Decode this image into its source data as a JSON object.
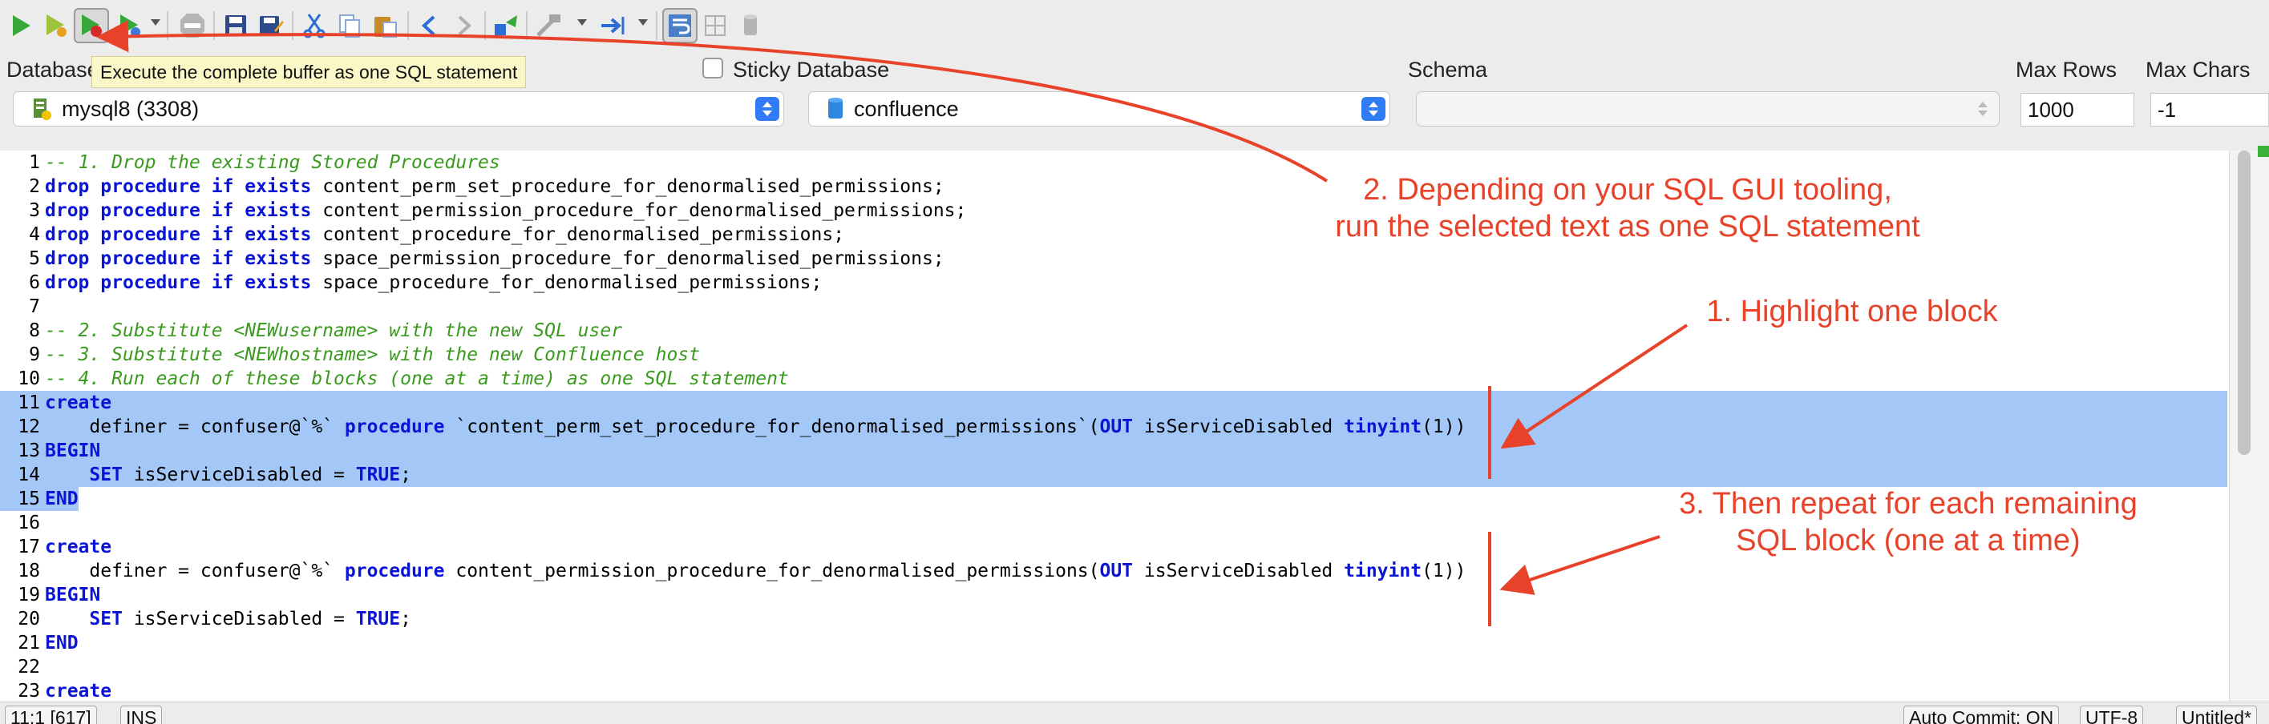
{
  "toolbar": {
    "tooltip": "Execute the complete buffer as one SQL statement",
    "icons": [
      "execute-icon",
      "execute-selection-icon",
      "execute-buffer-icon",
      "execute-debug-icon",
      "stop-icon",
      "save-icon",
      "save-as-icon",
      "cut-icon",
      "copy-icon",
      "paste-icon",
      "undo-icon",
      "redo-icon",
      "run-script-icon",
      "tools-icon",
      "step-icon",
      "word-wrap-icon",
      "grid-icon",
      "database-icon"
    ]
  },
  "connection": {
    "database_label": "Database",
    "sticky_label": "Sticky Database",
    "sticky_checked": false,
    "schema_label": "Schema",
    "max_rows_label": "Max Rows",
    "max_chars_label": "Max Chars",
    "connection_value": "mysql8 (3308)",
    "database_value": "confluence",
    "schema_value": "",
    "max_rows_value": "1000",
    "max_chars_value": "-1"
  },
  "editor": {
    "lines": [
      {
        "n": "1",
        "segments": [
          {
            "t": "-- 1. Drop the existing Stored Procedures",
            "k": "c"
          }
        ]
      },
      {
        "n": "2",
        "segments": [
          {
            "t": "drop",
            "k": "k"
          },
          {
            "t": " "
          },
          {
            "t": "procedure",
            "k": "k"
          },
          {
            "t": " "
          },
          {
            "t": "if",
            "k": "k"
          },
          {
            "t": " "
          },
          {
            "t": "exists",
            "k": "k"
          },
          {
            "t": " content_perm_set_procedure_for_denormalised_permissions;"
          }
        ]
      },
      {
        "n": "3",
        "segments": [
          {
            "t": "drop",
            "k": "k"
          },
          {
            "t": " "
          },
          {
            "t": "procedure",
            "k": "k"
          },
          {
            "t": " "
          },
          {
            "t": "if",
            "k": "k"
          },
          {
            "t": " "
          },
          {
            "t": "exists",
            "k": "k"
          },
          {
            "t": " content_permission_procedure_for_denormalised_permissions;"
          }
        ]
      },
      {
        "n": "4",
        "segments": [
          {
            "t": "drop",
            "k": "k"
          },
          {
            "t": " "
          },
          {
            "t": "procedure",
            "k": "k"
          },
          {
            "t": " "
          },
          {
            "t": "if",
            "k": "k"
          },
          {
            "t": " "
          },
          {
            "t": "exists",
            "k": "k"
          },
          {
            "t": " content_procedure_for_denormalised_permissions;"
          }
        ]
      },
      {
        "n": "5",
        "segments": [
          {
            "t": "drop",
            "k": "k"
          },
          {
            "t": " "
          },
          {
            "t": "procedure",
            "k": "k"
          },
          {
            "t": " "
          },
          {
            "t": "if",
            "k": "k"
          },
          {
            "t": " "
          },
          {
            "t": "exists",
            "k": "k"
          },
          {
            "t": " space_permission_procedure_for_denormalised_permissions;"
          }
        ]
      },
      {
        "n": "6",
        "segments": [
          {
            "t": "drop",
            "k": "k"
          },
          {
            "t": " "
          },
          {
            "t": "procedure",
            "k": "k"
          },
          {
            "t": " "
          },
          {
            "t": "if",
            "k": "k"
          },
          {
            "t": " "
          },
          {
            "t": "exists",
            "k": "k"
          },
          {
            "t": " space_procedure_for_denormalised_permissions;"
          }
        ]
      },
      {
        "n": "7",
        "segments": []
      },
      {
        "n": "8",
        "segments": [
          {
            "t": "-- 2. Substitute <NEWusername> with the new SQL user",
            "k": "c"
          }
        ]
      },
      {
        "n": "9",
        "segments": [
          {
            "t": "-- 3. Substitute <NEWhostname> with the new Confluence host",
            "k": "c"
          }
        ]
      },
      {
        "n": "10",
        "segments": [
          {
            "t": "-- 4. Run each of these blocks (one at a time) as one SQL statement",
            "k": "c"
          }
        ]
      },
      {
        "n": "11",
        "sel": "full",
        "segments": [
          {
            "t": "create",
            "k": "k"
          }
        ]
      },
      {
        "n": "12",
        "sel": "full",
        "segments": [
          {
            "t": "    definer = confuser@`%` "
          },
          {
            "t": "procedure",
            "k": "k"
          },
          {
            "t": " `content_perm_set_procedure_for_denormalised_permissions`("
          },
          {
            "t": "OUT",
            "k": "k"
          },
          {
            "t": " isServiceDisabled "
          },
          {
            "t": "tinyint",
            "k": "k"
          },
          {
            "t": "(1))"
          }
        ]
      },
      {
        "n": "13",
        "sel": "full",
        "segments": [
          {
            "t": "BEGIN",
            "k": "k"
          }
        ]
      },
      {
        "n": "14",
        "sel": "full",
        "segments": [
          {
            "t": "    "
          },
          {
            "t": "SET",
            "k": "k"
          },
          {
            "t": " isServiceDisabled = "
          },
          {
            "t": "TRUE",
            "k": "k"
          },
          {
            "t": ";"
          }
        ]
      },
      {
        "n": "15",
        "sel": "partial",
        "segments": [
          {
            "t": "END",
            "k": "k"
          }
        ]
      },
      {
        "n": "16",
        "segments": []
      },
      {
        "n": "17",
        "segments": [
          {
            "t": "create",
            "k": "k"
          }
        ]
      },
      {
        "n": "18",
        "segments": [
          {
            "t": "    definer = confuser@`%` "
          },
          {
            "t": "procedure",
            "k": "k"
          },
          {
            "t": " content_permission_procedure_for_denormalised_permissions("
          },
          {
            "t": "OUT",
            "k": "k"
          },
          {
            "t": " isServiceDisabled "
          },
          {
            "t": "tinyint",
            "k": "k"
          },
          {
            "t": "(1))"
          }
        ]
      },
      {
        "n": "19",
        "segments": [
          {
            "t": "BEGIN",
            "k": "k"
          }
        ]
      },
      {
        "n": "20",
        "segments": [
          {
            "t": "    "
          },
          {
            "t": "SET",
            "k": "k"
          },
          {
            "t": " isServiceDisabled = "
          },
          {
            "t": "TRUE",
            "k": "k"
          },
          {
            "t": ";"
          }
        ]
      },
      {
        "n": "21",
        "segments": [
          {
            "t": "END",
            "k": "k"
          }
        ]
      },
      {
        "n": "22",
        "segments": []
      },
      {
        "n": "23",
        "segments": [
          {
            "t": "create",
            "k": "k"
          }
        ]
      }
    ]
  },
  "annotations": {
    "step2": [
      "2. Depending on your SQL GUI tooling,",
      "run the selected text as one SQL statement"
    ],
    "step1": [
      "1. Highlight one block"
    ],
    "step3": [
      "3. Then repeat for each remaining",
      "SQL block (one at a time)"
    ],
    "color": "#e8432a"
  },
  "status": {
    "position": "11:1 [617]",
    "mode": "INS",
    "auto_commit": "Auto Commit: ON",
    "encoding": "UTF-8",
    "tab": "Untitled*"
  },
  "colors": {
    "keyword": "#0a14d6",
    "comment": "#3a9a1e",
    "selection": "#a3c8f8",
    "tooltip_bg": "#fbf8c8",
    "combo_accent": "#2f7cf6"
  }
}
